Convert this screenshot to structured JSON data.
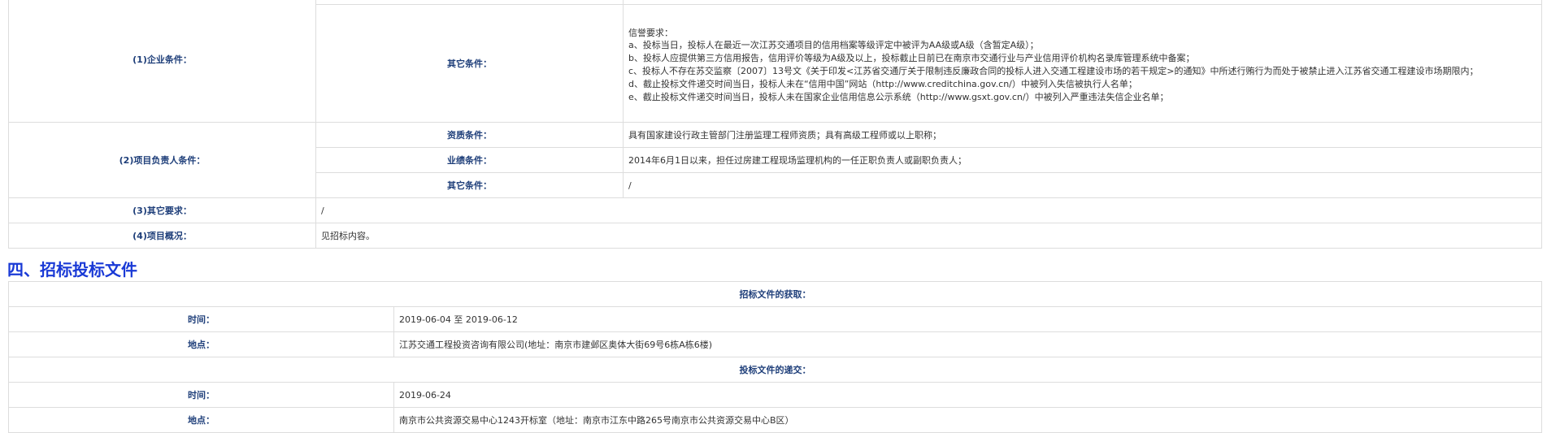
{
  "qualification": {
    "enterprise": {
      "label": "(1)企业条件：",
      "other_label": "其它条件：",
      "other_lines": [
        "信誉要求：",
        "a、投标当日，投标人在最近一次江苏交通项目的信用档案等级评定中被评为AA级或A级（含暂定A级）；",
        "b、投标人应提供第三方信用报告，信用评价等级为A级及以上，投标截止日前已在南京市交通行业与产业信用评价机构名录库管理系统中备案；",
        "c、投标人不存在苏交监察〔2007〕13号文《关于印发<江苏省交通厅关于限制违反廉政合同的投标人进入交通工程建设市场的若干规定>的通知》中所述行贿行为而处于被禁止进入江苏省交通工程建设市场期限内；",
        "d、截止投标文件递交时间当日，投标人未在“信用中国”网站（http://www.creditchina.gov.cn/）中被列入失信被执行人名单；",
        "e、截止投标文件递交时间当日，投标人未在国家企业信用信息公示系统（http://www.gsxt.gov.cn/）中被列入严重违法失信企业名单；"
      ]
    },
    "manager": {
      "label": "(2)项目负责人条件：",
      "qual_label": "资质条件：",
      "qual_value": "具有国家建设行政主管部门注册监理工程师资质；具有高级工程师或以上职称；",
      "perf_label": "业绩条件：",
      "perf_value": "2014年6月1日以来，担任过房建工程现场监理机构的一任正职负责人或副职负责人；",
      "other_label": "其它条件：",
      "other_value": "/"
    },
    "other_req": {
      "label": "(3)其它要求：",
      "value": "/"
    },
    "overview": {
      "label": "(4)项目概况：",
      "value": "见招标内容。"
    }
  },
  "section_title": "四、招标投标文件",
  "documents": {
    "obtain_header": "招标文件的获取：",
    "obtain_time_label": "时间：",
    "obtain_time_value": "2019-06-04 至 2019-06-12",
    "obtain_place_label": "地点：",
    "obtain_place_value": "江苏交通工程投资咨询有限公司(地址：南京市建邺区奥体大街69号6栋A栋6楼)",
    "submit_header": "投标文件的递交：",
    "submit_time_label": "时间：",
    "submit_time_value": "2019-06-24",
    "submit_place_label": "地点：",
    "submit_place_value": "南京市公共资源交易中心1243开标室（地址：南京市江东中路265号南京市公共资源交易中心B区）"
  }
}
